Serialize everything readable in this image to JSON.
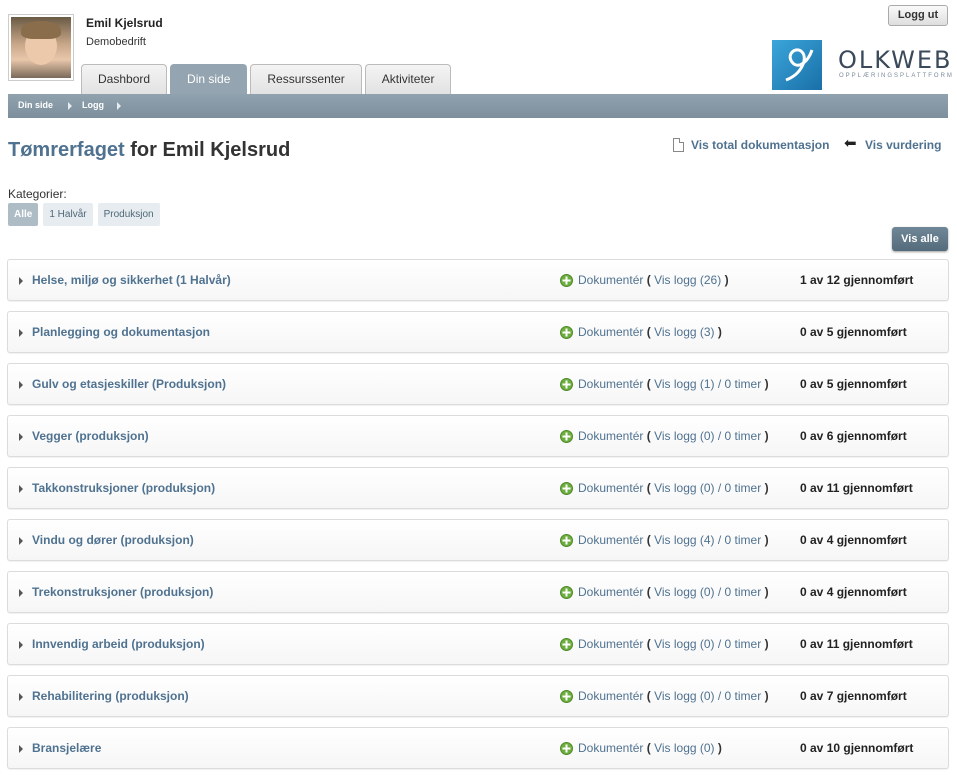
{
  "user": {
    "name": "Emil Kjelsrud",
    "company": "Demobedrift"
  },
  "header": {
    "logout_label": "Logg ut",
    "logo_name": "OLKWEB",
    "logo_tagline": "OPPLÆRINGSPLATTFORM"
  },
  "tabs": [
    {
      "label": "Dashbord",
      "active": false
    },
    {
      "label": "Din side",
      "active": true
    },
    {
      "label": "Ressurssenter",
      "active": false
    },
    {
      "label": "Aktiviteter",
      "active": false
    }
  ],
  "breadcrumb": [
    {
      "label": "Din side"
    },
    {
      "label": "Logg"
    }
  ],
  "title": {
    "course": "Tømrerfaget",
    "rest": " for Emil Kjelsrud"
  },
  "top_links": {
    "total_doc": "Vis total dokumentasjon",
    "vurdering": "Vis vurdering"
  },
  "categories": {
    "label": "Kategorier:",
    "items": [
      {
        "label": "Alle",
        "active": true
      },
      {
        "label": "1 Halvår",
        "active": false
      },
      {
        "label": "Produksjon",
        "active": false
      }
    ]
  },
  "vis_alle_label": "Vis alle",
  "rows": [
    {
      "title": "Helse, miljø og sikkerhet (1 Halvår)",
      "doc": "Dokumentér",
      "log": "Vis logg (26)",
      "hours": "",
      "status": "1 av 12 gjennomført"
    },
    {
      "title": "Planlegging og dokumentasjon",
      "doc": "Dokumentér",
      "log": "Vis logg (3)",
      "hours": "",
      "status": "0 av 5 gjennomført"
    },
    {
      "title": "Gulv og etasjeskiller (Produksjon)",
      "doc": "Dokumentér",
      "log": "Vis logg (1)",
      "hours": " / 0 timer",
      "status": "0 av 5 gjennomført"
    },
    {
      "title": "Vegger (produksjon)",
      "doc": "Dokumentér",
      "log": "Vis logg (0)",
      "hours": " / 0 timer",
      "status": "0 av 6 gjennomført"
    },
    {
      "title": "Takkonstruksjoner (produksjon)",
      "doc": "Dokumentér",
      "log": "Vis logg (0)",
      "hours": " / 0 timer",
      "status": "0 av 11 gjennomført"
    },
    {
      "title": "Vindu og dører (produksjon)",
      "doc": "Dokumentér",
      "log": "Vis logg (4)",
      "hours": " / 0 timer",
      "status": "0 av 4 gjennomført"
    },
    {
      "title": "Trekonstruksjoner (produksjon)",
      "doc": "Dokumentér",
      "log": "Vis logg (0)",
      "hours": " / 0 timer",
      "status": "0 av 4 gjennomført"
    },
    {
      "title": "Innvendig arbeid (produksjon)",
      "doc": "Dokumentér",
      "log": "Vis logg (0)",
      "hours": " / 0 timer",
      "status": "0 av 11 gjennomført"
    },
    {
      "title": "Rehabilitering (produksjon)",
      "doc": "Dokumentér",
      "log": "Vis logg (0)",
      "hours": " / 0 timer",
      "status": "0 av 7 gjennomført"
    },
    {
      "title": "Bransjelære",
      "doc": "Dokumentér",
      "log": "Vis logg (0)",
      "hours": "",
      "status": "0 av 10 gjennomført"
    }
  ]
}
